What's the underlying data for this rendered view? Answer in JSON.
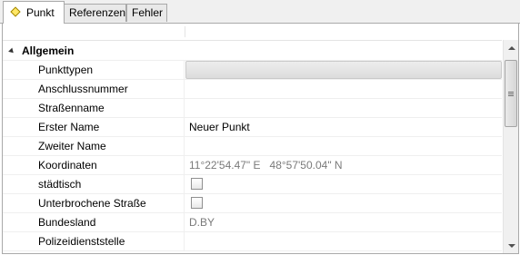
{
  "tabs": [
    {
      "label": "Punkt",
      "icon": "yellow-diamond-icon",
      "active": true
    },
    {
      "label": "Referenzen",
      "active": false
    },
    {
      "label": "Fehler",
      "active": false
    }
  ],
  "category": {
    "label": "Allgemein",
    "expanded": true
  },
  "properties": [
    {
      "name": "Punkttypen",
      "value": "",
      "type": "dropdown",
      "selected": true
    },
    {
      "name": "Anschlussnummer",
      "value": "",
      "type": "text"
    },
    {
      "name": "Straßenname",
      "value": "",
      "type": "text"
    },
    {
      "name": "Erster Name",
      "value": "Neuer Punkt",
      "type": "text"
    },
    {
      "name": "Zweiter Name",
      "value": "",
      "type": "text"
    },
    {
      "name": "Koordinaten",
      "value": "11°22'54.47\" E   48°57'50.04\" N",
      "type": "readonly"
    },
    {
      "name": "städtisch",
      "value": "",
      "type": "checkbox",
      "checked": false
    },
    {
      "name": "Unterbrochene Straße",
      "value": "",
      "type": "checkbox",
      "checked": false
    },
    {
      "name": "Bundesland",
      "value": "D.BY",
      "type": "readonly"
    },
    {
      "name": "Polizeidienststelle",
      "value": "",
      "type": "text"
    }
  ],
  "colors": {
    "border": "#a9a9a9",
    "tab_inactive": "#e9e9e9",
    "readonly_text": "#7a7a7a",
    "diamond_fill": "#ffe766"
  }
}
